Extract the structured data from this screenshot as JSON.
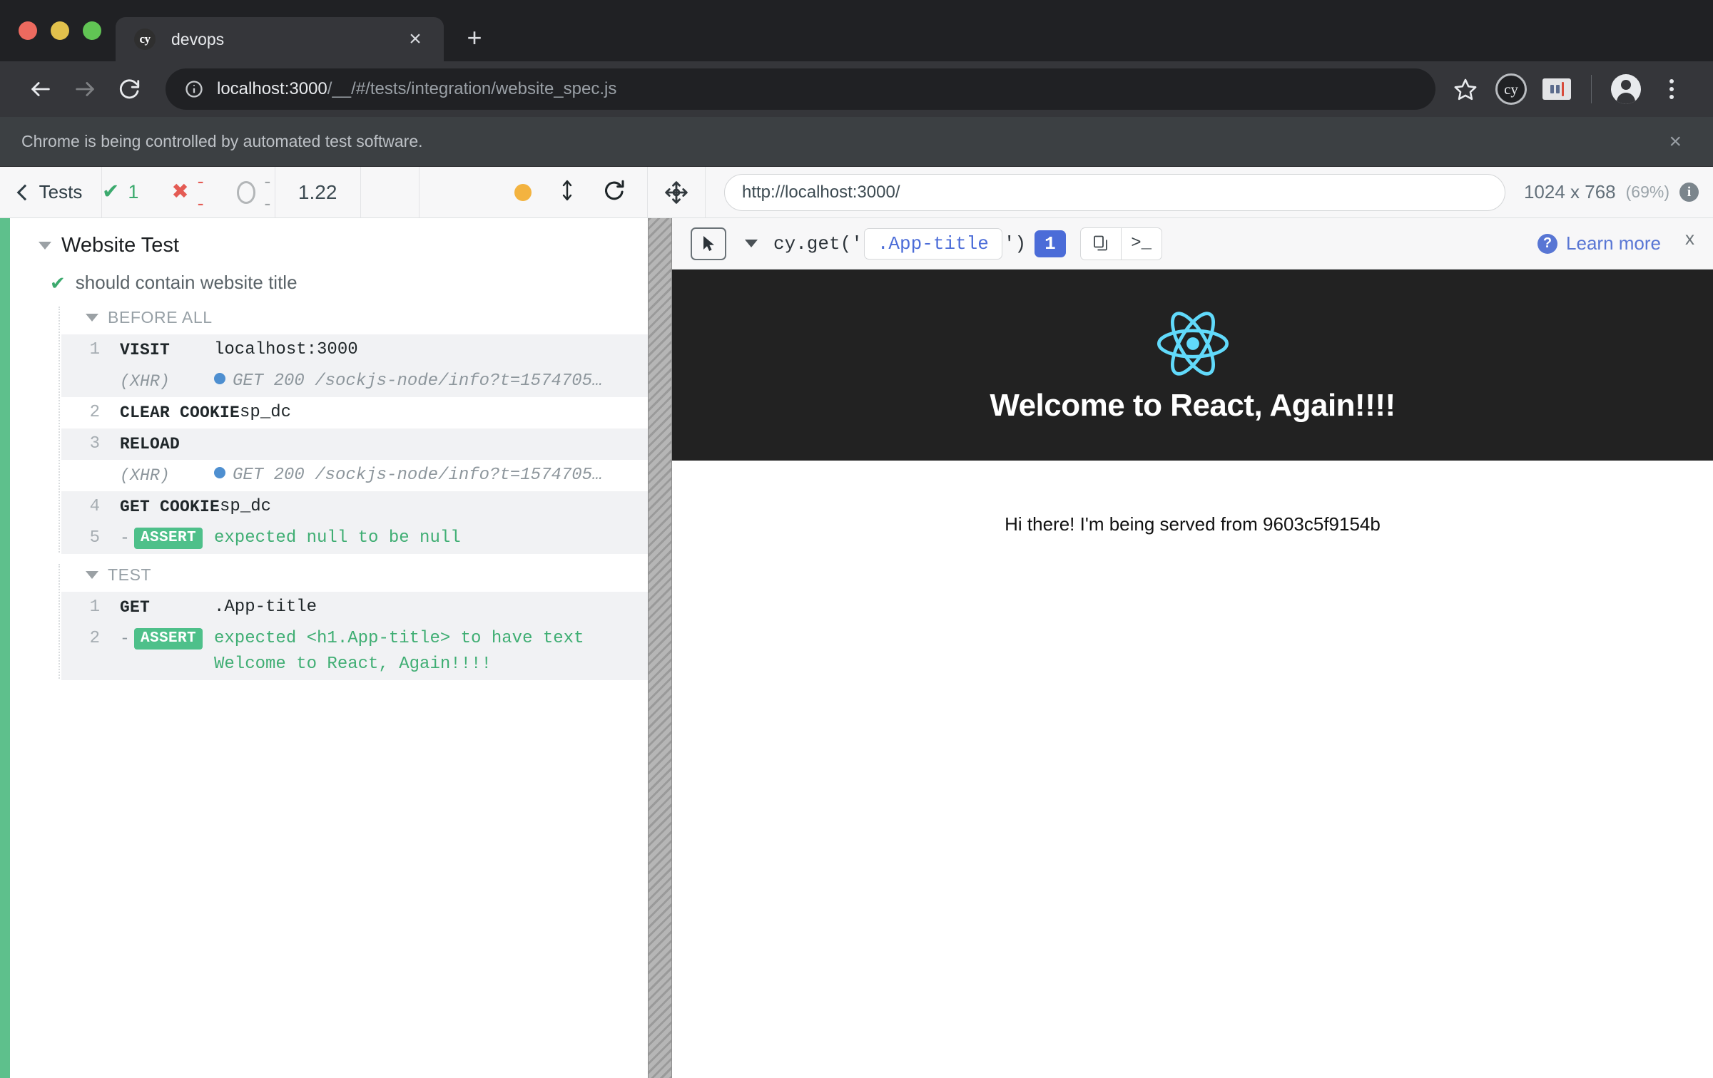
{
  "browser": {
    "tab": {
      "favicon_label": "cy",
      "title": "devops",
      "close_label": "×"
    },
    "new_tab_label": "+",
    "nav": {
      "back": "←",
      "forward": "→",
      "reload": "⟳"
    },
    "address": {
      "host": "localhost:3000",
      "path": "/__/#/tests/integration/website_spec.js",
      "full": "localhost:3000/__/#/tests/integration/website_spec.js"
    },
    "toolbar_icons": [
      "bookmark-star-icon",
      "cy-extension-icon",
      "password-manager-icon",
      "profile-avatar",
      "chrome-menu-icon"
    ],
    "extension_cy_label": "cy",
    "infobar": {
      "message": "Chrome is being controlled by automated test software.",
      "close_label": "×"
    }
  },
  "cypress": {
    "header": {
      "back_label": "Tests",
      "stats": [
        {
          "name": "passed",
          "glyph": "✔",
          "value": "1",
          "color": "#3caa6e"
        },
        {
          "name": "failed",
          "glyph": "✖",
          "value": "--",
          "color": "#e45b54"
        },
        {
          "name": "pending",
          "glyph": "ring",
          "value": "--",
          "color": "#9fa3a6"
        }
      ],
      "duration": "1.22",
      "controls": [
        "recording-dot",
        "resize-arrows-icon",
        "restart-icon"
      ],
      "url_value": "http://localhost:3000/",
      "viewport_size": "1024 x 768",
      "viewport_scale": "(69%)"
    },
    "reporter": {
      "suite": "Website Test",
      "test": "should contain website title",
      "hooks": [
        {
          "label": "BEFORE ALL",
          "commands": [
            {
              "num": "1",
              "name": "VISIT",
              "message": "localhost:3000",
              "type": "command",
              "alt": true
            },
            {
              "num": "",
              "name": "(XHR)",
              "message": "GET 200 /sockjs-node/info?t=1574705…",
              "type": "xhr",
              "alt": true
            },
            {
              "num": "2",
              "name": "CLEAR COOKIE",
              "message": "sp_dc",
              "type": "command",
              "alt": false
            },
            {
              "num": "3",
              "name": "RELOAD",
              "message": "",
              "type": "command",
              "alt": true
            },
            {
              "num": "",
              "name": "(XHR)",
              "message": "GET 200 /sockjs-node/info?t=1574705…",
              "type": "xhr",
              "alt": false
            },
            {
              "num": "4",
              "name": "GET COOKIE",
              "message": "sp_dc",
              "type": "command",
              "alt": true
            },
            {
              "num": "5",
              "name": "ASSERT",
              "message": "expected null to be null",
              "type": "assert",
              "alt": true
            }
          ]
        },
        {
          "label": "TEST",
          "commands": [
            {
              "num": "1",
              "name": "GET",
              "message": ".App-title",
              "type": "command",
              "alt": true
            },
            {
              "num": "2",
              "name": "ASSERT",
              "message": "expected <h1.App-title> to have text Welcome to React, Again!!!!",
              "type": "assert",
              "alt": true
            }
          ]
        }
      ]
    },
    "selector_playground": {
      "cursor_icon": "pointer-select-icon",
      "code_prefix": "cy.get('",
      "selector": ".App-title",
      "code_suffix": "')",
      "match_count": "1",
      "copy_label": "copy-to-clipboard-icon",
      "console_label": ">_",
      "learn_more": "Learn more",
      "close_label": "x"
    }
  },
  "app_preview": {
    "logo": "react-atom-logo",
    "title": "Welcome to React, Again!!!!",
    "intro": "Hi there! I'm being served from 9603c5f9154b",
    "header_bg": "#222222",
    "logo_color": "#61dafb"
  }
}
